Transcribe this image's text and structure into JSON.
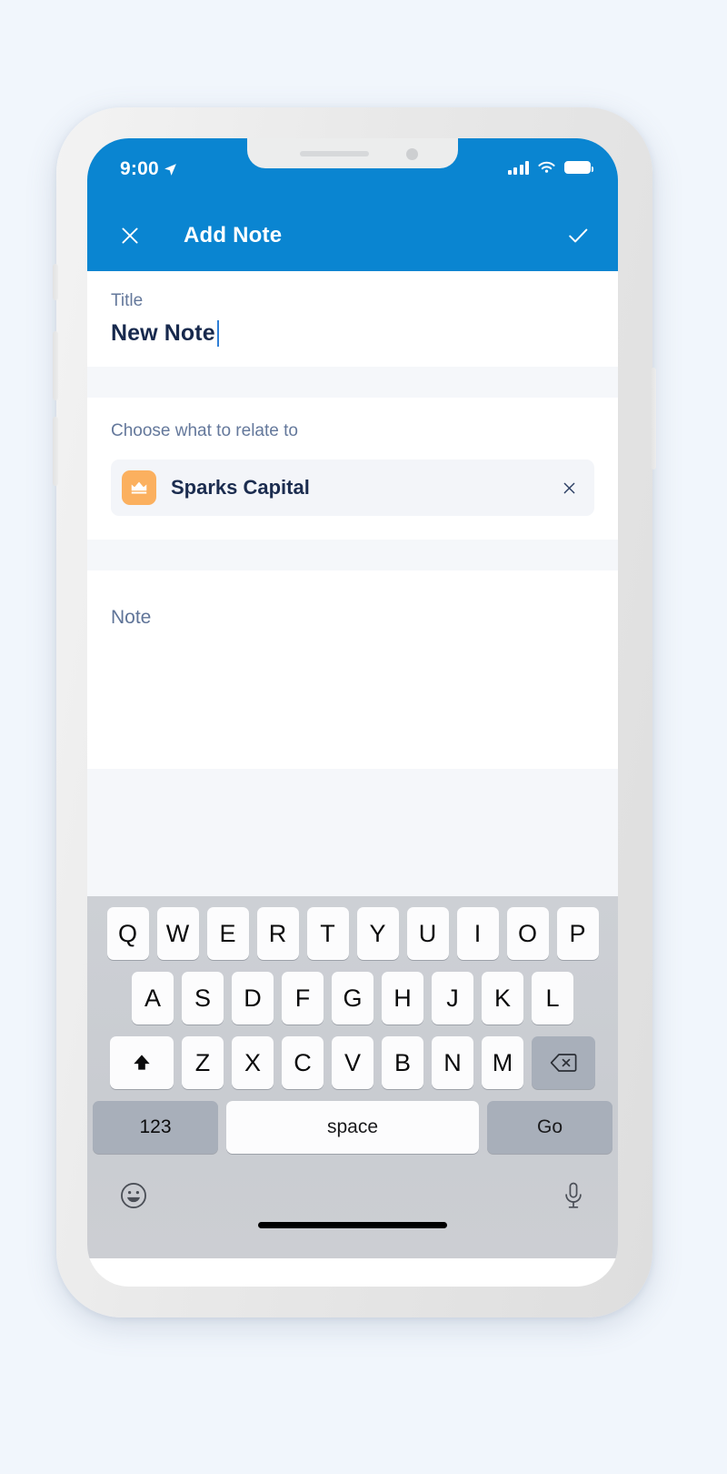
{
  "status_bar": {
    "time": "9:00",
    "location_icon": "location-arrow-icon",
    "signal_icon": "cellular-signal-icon",
    "wifi_icon": "wifi-icon",
    "battery_icon": "battery-full-icon"
  },
  "navbar": {
    "close_icon": "close-x-icon",
    "title": "Add Note",
    "confirm_icon": "checkmark-icon"
  },
  "form": {
    "title_field": {
      "label": "Title",
      "value": "New Note",
      "placeholder": "Title"
    },
    "relate_field": {
      "label": "Choose what to relate to",
      "chip": {
        "icon": "crown-icon",
        "label": "Sparks Capital",
        "remove_icon": "close-x-icon"
      }
    },
    "note_field": {
      "placeholder": "Note",
      "value": ""
    }
  },
  "keyboard": {
    "row1": [
      "Q",
      "W",
      "E",
      "R",
      "T",
      "Y",
      "U",
      "I",
      "O",
      "P"
    ],
    "row2": [
      "A",
      "S",
      "D",
      "F",
      "G",
      "H",
      "J",
      "K",
      "L"
    ],
    "row3": [
      "Z",
      "X",
      "C",
      "V",
      "B",
      "N",
      "M"
    ],
    "shift_icon": "shift-arrow-icon",
    "backspace_icon": "backspace-delete-icon",
    "numeric_label": "123",
    "space_label": "space",
    "return_label": "Go",
    "emoji_icon": "emoji-smiley-icon",
    "dictation_icon": "microphone-icon"
  },
  "colors": {
    "accent": "#0a85d1",
    "page_background": "#f1f6fc",
    "chip_icon_background": "#fbb05f",
    "text_dark": "#17294d",
    "label_muted": "#64789b"
  }
}
